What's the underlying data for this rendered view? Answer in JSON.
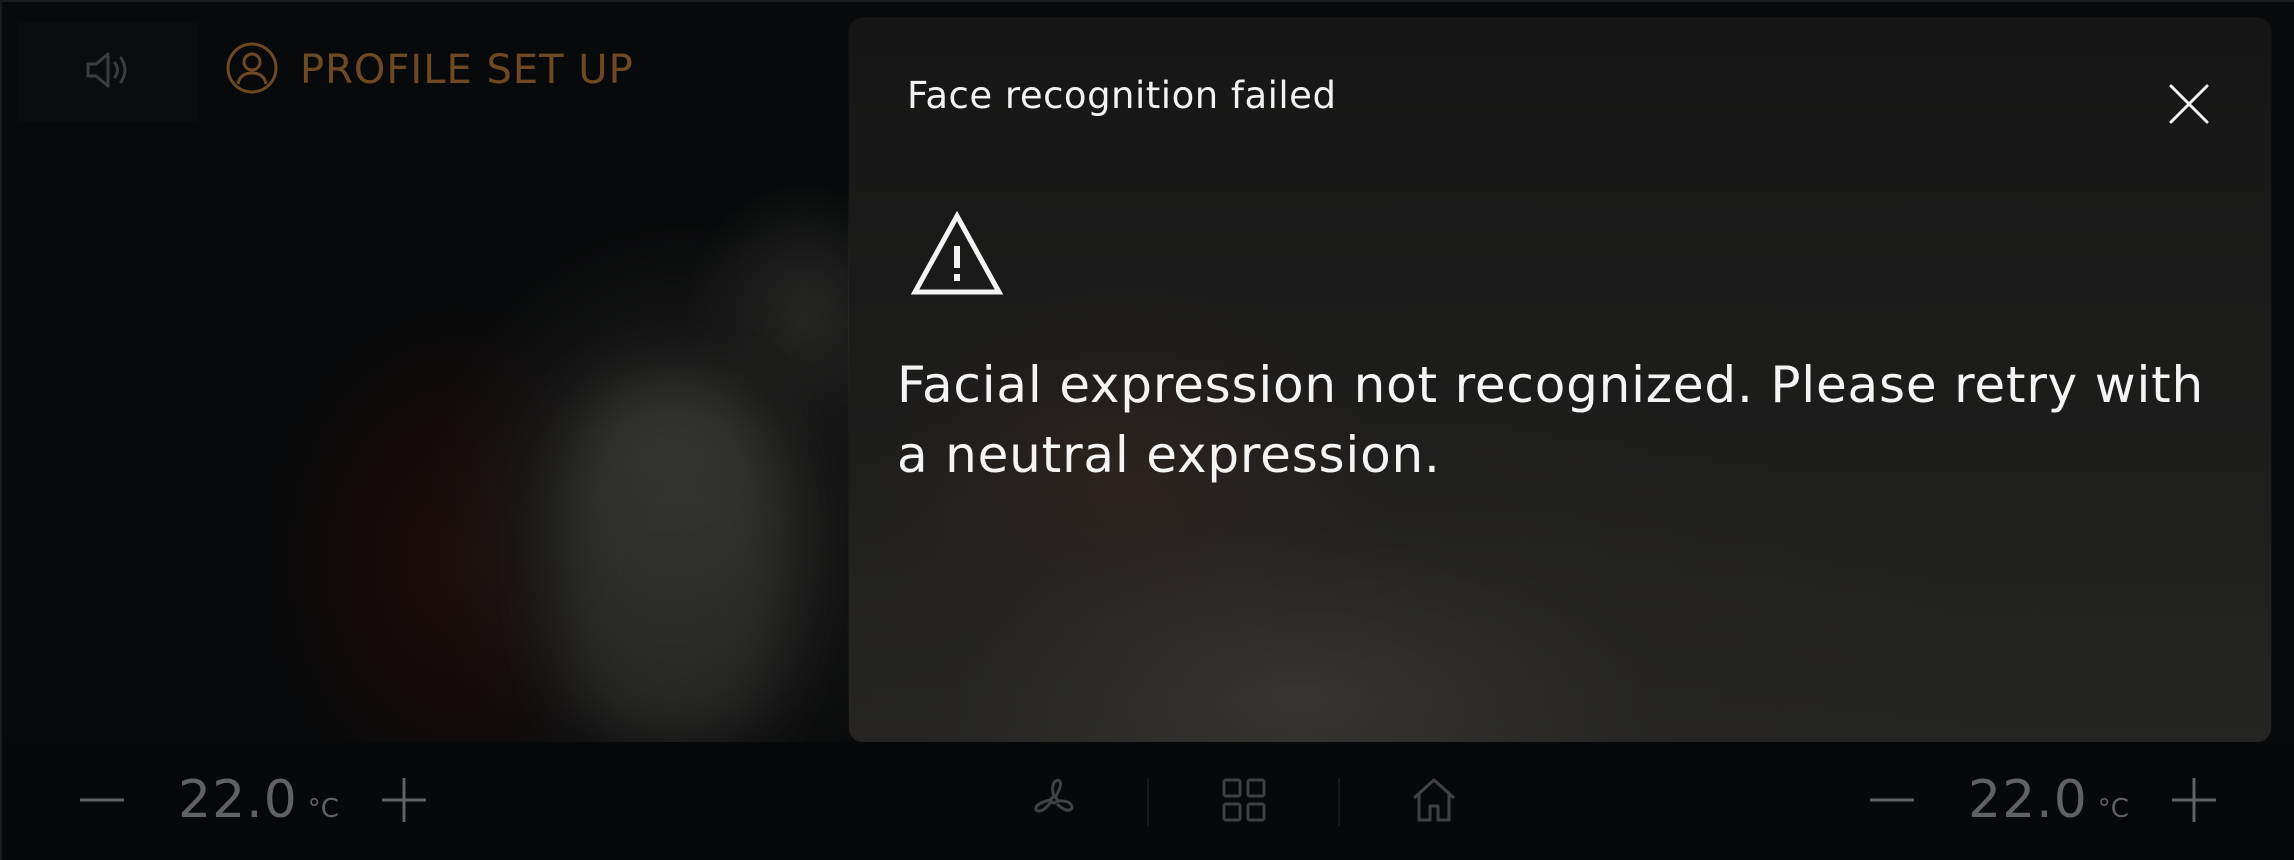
{
  "top_bar": {
    "sound_icon": "speaker-icon",
    "profile_icon": "user-circle-icon",
    "profile_title": "PROFILE SET UP"
  },
  "dialog": {
    "title": "Face recognition failed",
    "close_icon": "close-icon",
    "warning_icon": "warning-triangle-icon",
    "message": "Facial expression not recognized. Please retry with a neutral expression."
  },
  "climate": {
    "left": {
      "decrease_icon": "minus-icon",
      "temperature": "22.0",
      "unit": "°C",
      "increase_icon": "plus-icon"
    },
    "right": {
      "decrease_icon": "minus-icon",
      "temperature": "22.0",
      "unit": "°C",
      "increase_icon": "plus-icon"
    },
    "fan_icon": "fan-icon",
    "apps_icon": "apps-grid-icon",
    "home_icon": "home-icon"
  },
  "colors": {
    "accent_orange": "#6e4a24",
    "text_white": "#f2f2f2",
    "icon_grey": "#5f6164"
  }
}
